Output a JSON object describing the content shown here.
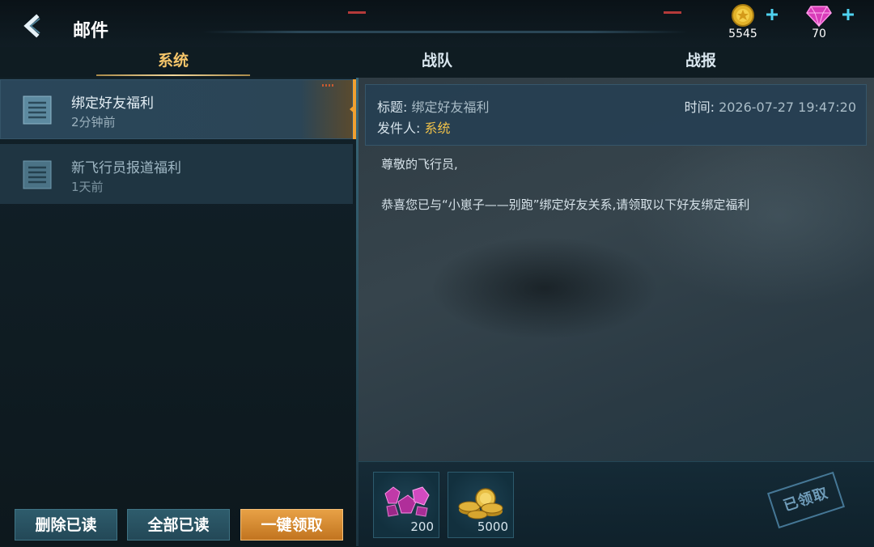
{
  "header": {
    "title": "邮件",
    "back_icon": "back-chevron-icon",
    "currencies": [
      {
        "name": "coin",
        "icon": "gold-coin-icon",
        "amount": "5545",
        "add_icon": "plus-icon"
      },
      {
        "name": "gem",
        "icon": "pink-gem-icon",
        "amount": "70",
        "add_icon": "plus-icon"
      }
    ]
  },
  "tabs": [
    {
      "label": "系统",
      "active": true
    },
    {
      "label": "战队",
      "active": false
    },
    {
      "label": "战报",
      "active": false
    }
  ],
  "mail_list": [
    {
      "title": "绑定好友福利",
      "time": "2分钟前",
      "selected": true,
      "read": false
    },
    {
      "title": "新飞行员报道福利",
      "time": "1天前",
      "selected": false,
      "read": true
    }
  ],
  "actions": {
    "delete_read": "删除已读",
    "mark_all_read": "全部已读",
    "claim_all": "一键领取"
  },
  "mail_detail": {
    "subject_label": "标题:",
    "subject": "绑定好友福利",
    "time_label": "时间:",
    "time": "2026-07-27 19:47:20",
    "sender_label": "发件人:",
    "sender": "系统",
    "greeting": "尊敬的飞行员,",
    "body": "恭喜您已与“小崽子——别跑”绑定好友关系,请领取以下好友绑定福利",
    "rewards": [
      {
        "icon": "pink-gem-pile-icon",
        "quantity": "200"
      },
      {
        "icon": "gold-coin-stack-icon",
        "quantity": "5000"
      }
    ],
    "claimed_stamp": "已领取"
  },
  "colors": {
    "accent_gold": "#f0a030",
    "sender_yellow": "#f0c24a",
    "active_tab": "#f5c56a"
  }
}
